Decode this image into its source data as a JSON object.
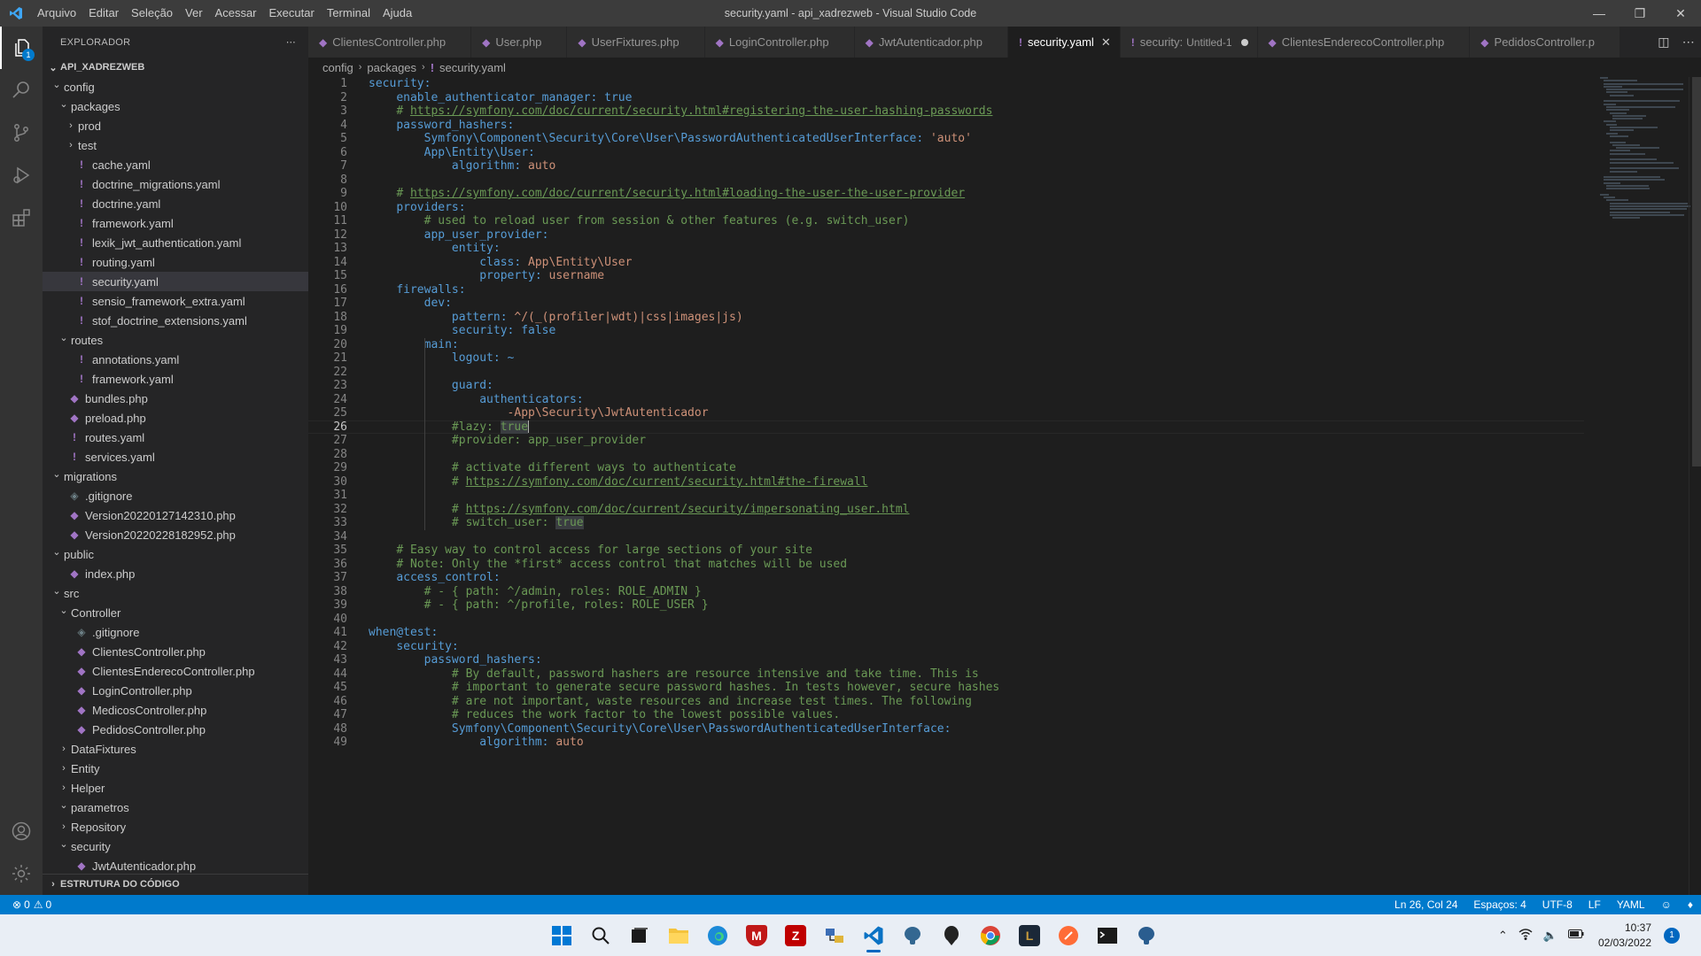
{
  "window": {
    "title": "security.yaml - api_xadrezweb - Visual Studio Code",
    "menu": [
      "Arquivo",
      "Editar",
      "Seleção",
      "Ver",
      "Acessar",
      "Executar",
      "Terminal",
      "Ajuda"
    ]
  },
  "activity_bar": {
    "explorer_badge": "1"
  },
  "sidebar": {
    "title": "EXPLORADOR",
    "project": "API_XADREZWEB",
    "outline_section": "ESTRUTURA DO CÓDIGO",
    "tree": [
      {
        "label": "config",
        "type": "folder",
        "open": true,
        "depth": 1
      },
      {
        "label": "packages",
        "type": "folder",
        "open": true,
        "depth": 2
      },
      {
        "label": "prod",
        "type": "folder",
        "open": false,
        "depth": 3
      },
      {
        "label": "test",
        "type": "folder",
        "open": false,
        "depth": 3
      },
      {
        "label": "cache.yaml",
        "type": "yaml",
        "depth": 3
      },
      {
        "label": "doctrine_migrations.yaml",
        "type": "yaml",
        "depth": 3
      },
      {
        "label": "doctrine.yaml",
        "type": "yaml",
        "depth": 3
      },
      {
        "label": "framework.yaml",
        "type": "yaml",
        "depth": 3
      },
      {
        "label": "lexik_jwt_authentication.yaml",
        "type": "yaml",
        "depth": 3
      },
      {
        "label": "routing.yaml",
        "type": "yaml",
        "depth": 3
      },
      {
        "label": "security.yaml",
        "type": "yaml",
        "depth": 3,
        "selected": true
      },
      {
        "label": "sensio_framework_extra.yaml",
        "type": "yaml",
        "depth": 3
      },
      {
        "label": "stof_doctrine_extensions.yaml",
        "type": "yaml",
        "depth": 3
      },
      {
        "label": "routes",
        "type": "folder",
        "open": true,
        "depth": 2
      },
      {
        "label": "annotations.yaml",
        "type": "yaml",
        "depth": 3
      },
      {
        "label": "framework.yaml",
        "type": "yaml",
        "depth": 3
      },
      {
        "label": "bundles.php",
        "type": "php",
        "depth": 2
      },
      {
        "label": "preload.php",
        "type": "php",
        "depth": 2
      },
      {
        "label": "routes.yaml",
        "type": "yaml",
        "depth": 2
      },
      {
        "label": "services.yaml",
        "type": "yaml",
        "depth": 2
      },
      {
        "label": "migrations",
        "type": "folder",
        "open": true,
        "depth": 1
      },
      {
        "label": ".gitignore",
        "type": "git",
        "depth": 2
      },
      {
        "label": "Version20220127142310.php",
        "type": "php",
        "depth": 2
      },
      {
        "label": "Version20220228182952.php",
        "type": "php",
        "depth": 2
      },
      {
        "label": "public",
        "type": "folder",
        "open": true,
        "depth": 1
      },
      {
        "label": "index.php",
        "type": "php",
        "depth": 2
      },
      {
        "label": "src",
        "type": "folder",
        "open": true,
        "depth": 1
      },
      {
        "label": "Controller",
        "type": "folder",
        "open": true,
        "depth": 2
      },
      {
        "label": ".gitignore",
        "type": "git",
        "depth": 3
      },
      {
        "label": "ClientesController.php",
        "type": "php",
        "depth": 3
      },
      {
        "label": "ClientesEnderecoController.php",
        "type": "php",
        "depth": 3
      },
      {
        "label": "LoginController.php",
        "type": "php",
        "depth": 3
      },
      {
        "label": "MedicosController.php",
        "type": "php",
        "depth": 3
      },
      {
        "label": "PedidosController.php",
        "type": "php",
        "depth": 3
      },
      {
        "label": "DataFixtures",
        "type": "folder",
        "open": false,
        "depth": 2
      },
      {
        "label": "Entity",
        "type": "folder",
        "open": false,
        "depth": 2
      },
      {
        "label": "Helper",
        "type": "folder",
        "open": false,
        "depth": 2
      },
      {
        "label": "parametros",
        "type": "folder",
        "open": true,
        "depth": 2
      },
      {
        "label": "Repository",
        "type": "folder",
        "open": false,
        "depth": 2
      },
      {
        "label": "security",
        "type": "folder",
        "open": true,
        "depth": 2
      },
      {
        "label": "JwtAutenticador.php",
        "type": "php",
        "depth": 3
      }
    ]
  },
  "tabs": [
    {
      "label": "ClientesController.php",
      "icon": "php"
    },
    {
      "label": "User.php",
      "icon": "php"
    },
    {
      "label": "UserFixtures.php",
      "icon": "php"
    },
    {
      "label": "LoginController.php",
      "icon": "php"
    },
    {
      "label": "JwtAutenticador.php",
      "icon": "php"
    },
    {
      "label": "security.yaml",
      "icon": "yaml",
      "active": true
    },
    {
      "label": "security:",
      "sub": "Untitled-1",
      "icon": "yaml",
      "dirty": true
    },
    {
      "label": "ClientesEnderecoController.php",
      "icon": "php"
    },
    {
      "label": "PedidosController.p",
      "icon": "php"
    }
  ],
  "breadcrumb": [
    "config",
    "packages",
    "security.yaml"
  ],
  "editor": {
    "current_line": 26,
    "lines": [
      "security:",
      "    enable_authenticator_manager: true",
      "    # https://symfony.com/doc/current/security.html#registering-the-user-hashing-passwords",
      "    password_hashers:",
      "        Symfony\\Component\\Security\\Core\\User\\PasswordAuthenticatedUserInterface: 'auto'",
      "        App\\Entity\\User:",
      "            algorithm: auto",
      "",
      "    # https://symfony.com/doc/current/security.html#loading-the-user-the-user-provider",
      "    providers:",
      "        # used to reload user from session & other features (e.g. switch_user)",
      "        app_user_provider:",
      "            entity:",
      "                class: App\\Entity\\User",
      "                property: username",
      "    firewalls:",
      "        dev:",
      "            pattern: ^/(_(profiler|wdt)|css|images|js)",
      "            security: false",
      "        main:",
      "            logout: ~",
      "",
      "            guard:",
      "                authenticators:",
      "                    -App\\Security\\JwtAutenticador",
      "            #lazy: true",
      "            #provider: app_user_provider",
      "",
      "            # activate different ways to authenticate",
      "            # https://symfony.com/doc/current/security.html#the-firewall",
      "",
      "            # https://symfony.com/doc/current/security/impersonating_user.html",
      "            # switch_user: true",
      "",
      "    # Easy way to control access for large sections of your site",
      "    # Note: Only the *first* access control that matches will be used",
      "    access_control:",
      "        # - { path: ^/admin, roles: ROLE_ADMIN }",
      "        # - { path: ^/profile, roles: ROLE_USER }",
      "",
      "when@test:",
      "    security:",
      "        password_hashers:",
      "            # By default, password hashers are resource intensive and take time. This is",
      "            # important to generate secure password hashes. In tests however, secure hashes",
      "            # are not important, waste resources and increase test times. The following",
      "            # reduces the work factor to the lowest possible values.",
      "            Symfony\\Component\\Security\\Core\\User\\PasswordAuthenticatedUserInterface:",
      "                algorithm: auto"
    ]
  },
  "statusbar": {
    "errors": "0",
    "warnings": "0",
    "position": "Ln 26, Col 24",
    "spaces": "Espaços: 4",
    "encoding": "UTF-8",
    "eol": "LF",
    "language": "YAML"
  },
  "taskbar": {
    "time": "10:37",
    "date": "02/03/2022",
    "notifications": "1"
  }
}
